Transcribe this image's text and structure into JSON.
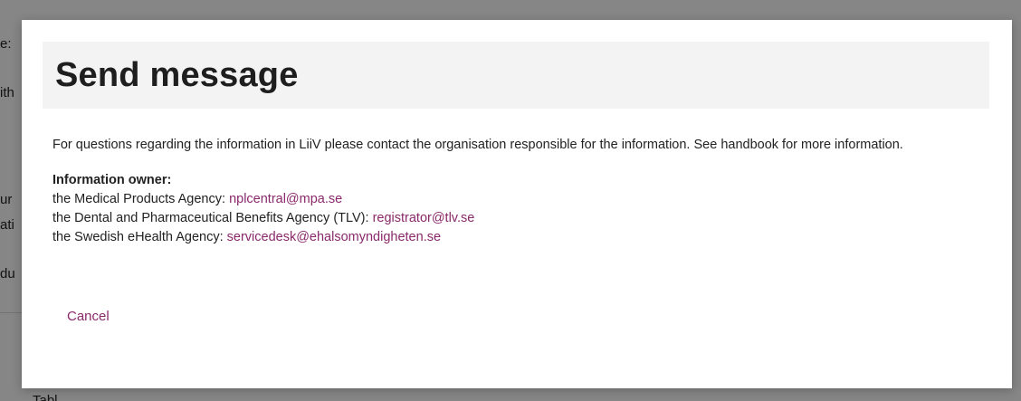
{
  "background": {
    "fragments": [
      "e:",
      "ith",
      "ur",
      "ati",
      "du",
      "Tabl"
    ]
  },
  "modal": {
    "title": "Send message",
    "intro": "For questions regarding the information in LiiV please contact the organisation responsible for the information. See handbook for more information.",
    "owner_heading": "Information owner:",
    "owners": [
      {
        "label": "the Medical Products Agency: ",
        "email": "nplcentral@mpa.se"
      },
      {
        "label": "the Dental and Pharmaceutical Benefits Agency (TLV): ",
        "email": "registrator@tlv.se"
      },
      {
        "label": "the Swedish eHealth Agency: ",
        "email": "servicedesk@ehalsomyndigheten.se"
      }
    ],
    "cancel_label": "Cancel"
  },
  "colors": {
    "accent": "#8a2a6b",
    "header_bg": "#f3f3f3",
    "text": "#222222"
  }
}
